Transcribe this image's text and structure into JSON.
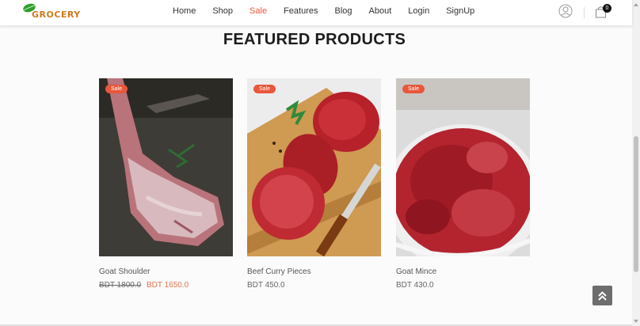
{
  "brand": {
    "logo_text": "GROCERY"
  },
  "nav": {
    "items": [
      {
        "label": "Home",
        "active": false
      },
      {
        "label": "Shop",
        "active": false
      },
      {
        "label": "Sale",
        "active": true
      },
      {
        "label": "Features",
        "active": false
      },
      {
        "label": "Blog",
        "active": false
      },
      {
        "label": "About",
        "active": false
      },
      {
        "label": "Login",
        "active": false
      },
      {
        "label": "SignUp",
        "active": false
      }
    ],
    "cart_count": "0"
  },
  "section": {
    "title": "FEATURED PRODUCTS"
  },
  "products": [
    {
      "name": "Goat Shoulder",
      "badge": "Sale",
      "old_price": "BDT 1800.0",
      "price": "BDT 1650.0"
    },
    {
      "name": "Beef Curry Pieces",
      "badge": "Sale",
      "price": "BDT 450.0"
    },
    {
      "name": "Goat Mince",
      "badge": "Sale",
      "price": "BDT 430.0"
    }
  ],
  "colors": {
    "accent": "#e8573a",
    "sale_price": "#e0764a",
    "button_gray": "#6d6d6d"
  },
  "icons": [
    "leaf-logo-icon",
    "user-icon",
    "cart-icon",
    "chevrons-up-icon"
  ]
}
